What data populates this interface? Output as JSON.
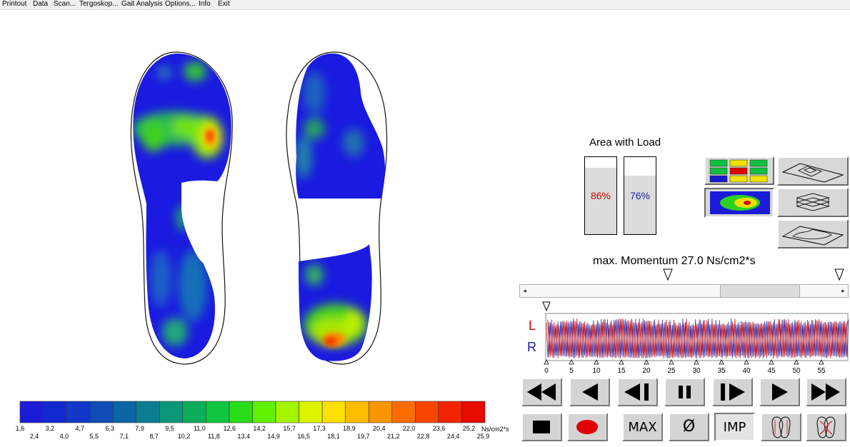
{
  "menu": [
    "Printout",
    "Data",
    "Scan...",
    "Tergoskop...",
    "Gait Analysis",
    "Options...",
    "Info",
    "Exit"
  ],
  "area_with_load": {
    "title": "Area with Load",
    "left_pct": "86%",
    "right_pct": "76%",
    "left_fill": 0.86,
    "right_fill": 0.76,
    "left_color": "#cc0000",
    "right_color": "#1a1aaa"
  },
  "momentum": {
    "label": "max. Momentum 27.0 Ns/cm2*s"
  },
  "scale": {
    "unit": "Ns/cm2*s",
    "row1": [
      "1,6",
      "3,2",
      "4,7",
      "6,3",
      "7,9",
      "9,5",
      "11,0",
      "12,6",
      "14,2",
      "15,7",
      "17,3",
      "18,9",
      "20,4",
      "22,0",
      "23,6",
      "25,2"
    ],
    "row2": [
      "2,4",
      "4,0",
      "5,5",
      "7,1",
      "8,7",
      "10,2",
      "11,8",
      "13,4",
      "14,9",
      "16,5",
      "18,1",
      "19,7",
      "21,2",
      "22,8",
      "24,4",
      "25,9"
    ],
    "colors": [
      "#1c1cd8",
      "#1428d0",
      "#1238c8",
      "#104cb8",
      "#0c66a4",
      "#0c7e92",
      "#0c9678",
      "#0cae5c",
      "#10c640",
      "#28dc18",
      "#60f000",
      "#a4f400",
      "#dcf400",
      "#fce000",
      "#fcbc00",
      "#fc9400",
      "#fc6c00",
      "#f84400",
      "#f02400",
      "#e60a00"
    ]
  },
  "graph": {
    "L": "L",
    "R": "R",
    "L_color": "#cc0000",
    "R_color": "#1a1aaa",
    "ticks": [
      "0",
      "5",
      "10",
      "15",
      "20",
      "25",
      "30",
      "35",
      "40",
      "45",
      "50",
      "55"
    ]
  },
  "buttons": {
    "max": "MAX",
    "avg": "Ø",
    "imp": "IMP"
  }
}
